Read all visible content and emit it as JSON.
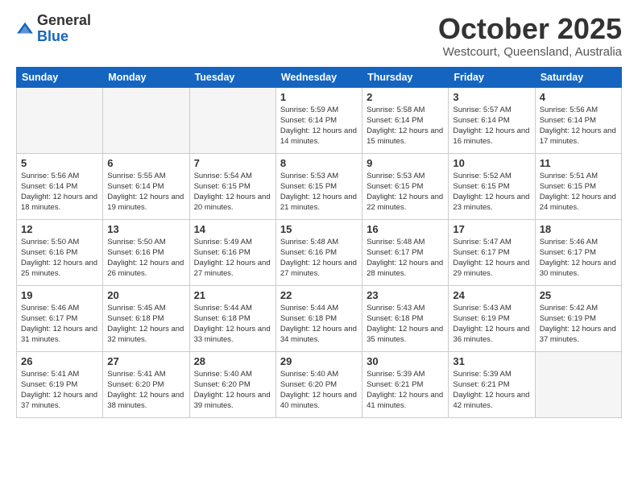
{
  "logo": {
    "general": "General",
    "blue": "Blue"
  },
  "header": {
    "month": "October 2025",
    "location": "Westcourt, Queensland, Australia"
  },
  "days_of_week": [
    "Sunday",
    "Monday",
    "Tuesday",
    "Wednesday",
    "Thursday",
    "Friday",
    "Saturday"
  ],
  "weeks": [
    [
      {
        "day": "",
        "empty": true
      },
      {
        "day": "",
        "empty": true
      },
      {
        "day": "",
        "empty": true
      },
      {
        "day": "1",
        "sunrise": "5:59 AM",
        "sunset": "6:14 PM",
        "daylight": "12 hours and 14 minutes."
      },
      {
        "day": "2",
        "sunrise": "5:58 AM",
        "sunset": "6:14 PM",
        "daylight": "12 hours and 15 minutes."
      },
      {
        "day": "3",
        "sunrise": "5:57 AM",
        "sunset": "6:14 PM",
        "daylight": "12 hours and 16 minutes."
      },
      {
        "day": "4",
        "sunrise": "5:56 AM",
        "sunset": "6:14 PM",
        "daylight": "12 hours and 17 minutes."
      }
    ],
    [
      {
        "day": "5",
        "sunrise": "5:56 AM",
        "sunset": "6:14 PM",
        "daylight": "12 hours and 18 minutes."
      },
      {
        "day": "6",
        "sunrise": "5:55 AM",
        "sunset": "6:14 PM",
        "daylight": "12 hours and 19 minutes."
      },
      {
        "day": "7",
        "sunrise": "5:54 AM",
        "sunset": "6:15 PM",
        "daylight": "12 hours and 20 minutes."
      },
      {
        "day": "8",
        "sunrise": "5:53 AM",
        "sunset": "6:15 PM",
        "daylight": "12 hours and 21 minutes."
      },
      {
        "day": "9",
        "sunrise": "5:53 AM",
        "sunset": "6:15 PM",
        "daylight": "12 hours and 22 minutes."
      },
      {
        "day": "10",
        "sunrise": "5:52 AM",
        "sunset": "6:15 PM",
        "daylight": "12 hours and 23 minutes."
      },
      {
        "day": "11",
        "sunrise": "5:51 AM",
        "sunset": "6:15 PM",
        "daylight": "12 hours and 24 minutes."
      }
    ],
    [
      {
        "day": "12",
        "sunrise": "5:50 AM",
        "sunset": "6:16 PM",
        "daylight": "12 hours and 25 minutes."
      },
      {
        "day": "13",
        "sunrise": "5:50 AM",
        "sunset": "6:16 PM",
        "daylight": "12 hours and 26 minutes."
      },
      {
        "day": "14",
        "sunrise": "5:49 AM",
        "sunset": "6:16 PM",
        "daylight": "12 hours and 27 minutes."
      },
      {
        "day": "15",
        "sunrise": "5:48 AM",
        "sunset": "6:16 PM",
        "daylight": "12 hours and 27 minutes."
      },
      {
        "day": "16",
        "sunrise": "5:48 AM",
        "sunset": "6:17 PM",
        "daylight": "12 hours and 28 minutes."
      },
      {
        "day": "17",
        "sunrise": "5:47 AM",
        "sunset": "6:17 PM",
        "daylight": "12 hours and 29 minutes."
      },
      {
        "day": "18",
        "sunrise": "5:46 AM",
        "sunset": "6:17 PM",
        "daylight": "12 hours and 30 minutes."
      }
    ],
    [
      {
        "day": "19",
        "sunrise": "5:46 AM",
        "sunset": "6:17 PM",
        "daylight": "12 hours and 31 minutes."
      },
      {
        "day": "20",
        "sunrise": "5:45 AM",
        "sunset": "6:18 PM",
        "daylight": "12 hours and 32 minutes."
      },
      {
        "day": "21",
        "sunrise": "5:44 AM",
        "sunset": "6:18 PM",
        "daylight": "12 hours and 33 minutes."
      },
      {
        "day": "22",
        "sunrise": "5:44 AM",
        "sunset": "6:18 PM",
        "daylight": "12 hours and 34 minutes."
      },
      {
        "day": "23",
        "sunrise": "5:43 AM",
        "sunset": "6:18 PM",
        "daylight": "12 hours and 35 minutes."
      },
      {
        "day": "24",
        "sunrise": "5:43 AM",
        "sunset": "6:19 PM",
        "daylight": "12 hours and 36 minutes."
      },
      {
        "day": "25",
        "sunrise": "5:42 AM",
        "sunset": "6:19 PM",
        "daylight": "12 hours and 37 minutes."
      }
    ],
    [
      {
        "day": "26",
        "sunrise": "5:41 AM",
        "sunset": "6:19 PM",
        "daylight": "12 hours and 37 minutes."
      },
      {
        "day": "27",
        "sunrise": "5:41 AM",
        "sunset": "6:20 PM",
        "daylight": "12 hours and 38 minutes."
      },
      {
        "day": "28",
        "sunrise": "5:40 AM",
        "sunset": "6:20 PM",
        "daylight": "12 hours and 39 minutes."
      },
      {
        "day": "29",
        "sunrise": "5:40 AM",
        "sunset": "6:20 PM",
        "daylight": "12 hours and 40 minutes."
      },
      {
        "day": "30",
        "sunrise": "5:39 AM",
        "sunset": "6:21 PM",
        "daylight": "12 hours and 41 minutes."
      },
      {
        "day": "31",
        "sunrise": "5:39 AM",
        "sunset": "6:21 PM",
        "daylight": "12 hours and 42 minutes."
      },
      {
        "day": "",
        "empty": true
      }
    ]
  ]
}
